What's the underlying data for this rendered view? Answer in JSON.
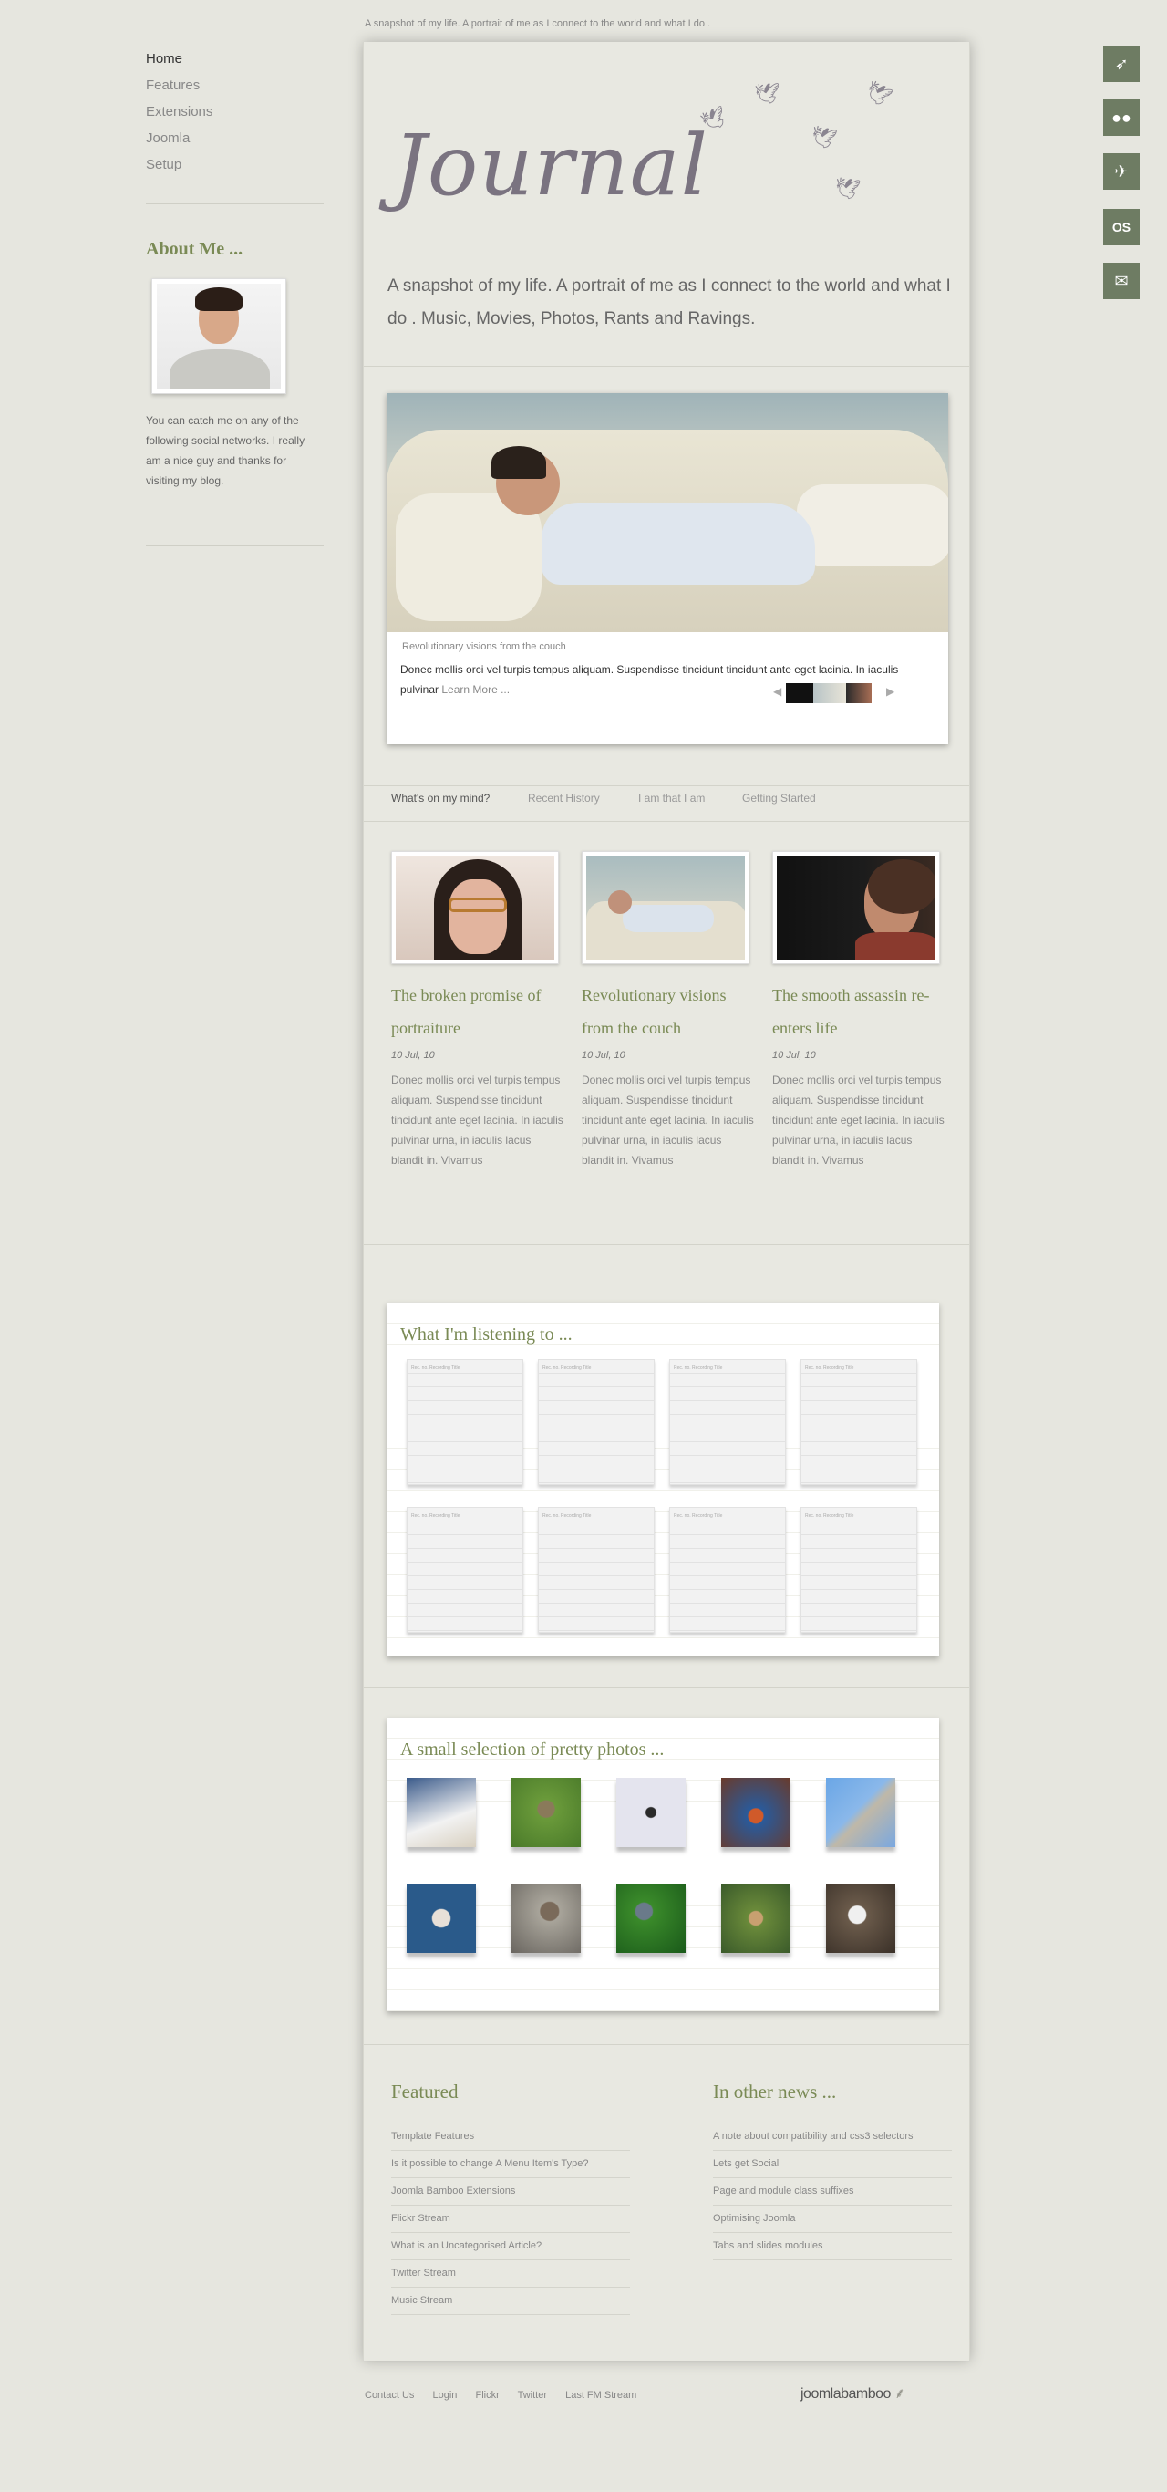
{
  "top_tagline": "A snapshot of my life. A portrait of me as I connect to the world and what I do .",
  "nav": [
    "Home",
    "Features",
    "Extensions",
    "Joomla",
    "Setup"
  ],
  "about": {
    "title": "About Me ...",
    "text": "You can catch me on any of the following social networks. I really am a nice guy and thanks for visiting my blog."
  },
  "header": {
    "logo": "Journal",
    "intro": "A snapshot of my life. A portrait of me as I connect to the world and what I do . Music, Movies, Photos, Rants and Ravings."
  },
  "slider": {
    "caption": "Revolutionary visions from the couch",
    "text": "Donec mollis orci vel turpis tempus aliquam. Suspendisse tincidunt tincidunt ante eget lacinia. In iaculis pulvinar",
    "more": "Learn More ...",
    "prev": "◀",
    "next": "▶"
  },
  "tabs": [
    "What's on my mind?",
    "Recent History",
    "I am that I am",
    "Getting Started"
  ],
  "posts": [
    {
      "title": "The broken promise of portraiture",
      "date": "10 Jul, 10",
      "body": "Donec mollis orci vel turpis tempus aliquam. Suspendisse tincidunt tincidunt ante eget lacinia. In iaculis pulvinar urna, in iaculis lacus blandit in. Vivamus"
    },
    {
      "title": "Revolutionary visions from the couch",
      "date": "10 Jul, 10",
      "body": "Donec mollis orci vel turpis tempus aliquam. Suspendisse tincidunt tincidunt ante eget lacinia. In iaculis pulvinar urna, in iaculis lacus blandit in. Vivamus"
    },
    {
      "title": "The smooth assassin re-enters life",
      "date": "10 Jul, 10",
      "body": "Donec mollis orci vel turpis tempus aliquam. Suspendisse tincidunt tincidunt ante eget lacinia. In iaculis pulvinar urna, in iaculis lacus blandit in. Vivamus"
    }
  ],
  "listening": {
    "title": "What I'm listening to ...",
    "card_header": "Rec. no.   Recording Title"
  },
  "photos": {
    "title": "A small selection of pretty photos ..."
  },
  "featured": {
    "title": "Featured",
    "links": [
      "Template Features",
      "Is it possible to change A Menu Item's Type?",
      "Joomla Bamboo Extensions",
      "Flickr Stream",
      "What is an Uncategorised Article?",
      "Twitter Stream",
      "Music Stream"
    ]
  },
  "news": {
    "title": "In other news ...",
    "links": [
      "A note about compatibility and css3 selectors",
      "Lets get Social",
      "Page and module class suffixes",
      "Optimising Joomla",
      "Tabs and slides modules"
    ]
  },
  "footer_links": [
    "Contact Us",
    "Login",
    "Flickr",
    "Twitter",
    "Last FM Stream"
  ],
  "brand": "joomlabamboo",
  "social_icons": [
    "twitter-bird-icon",
    "flickr-icon",
    "bird-icon",
    "lastfm-icon",
    "mail-icon"
  ],
  "colors": {
    "accent": "#7a8a55",
    "social_bg": "#6e7c63",
    "background": "#e6e6df"
  }
}
